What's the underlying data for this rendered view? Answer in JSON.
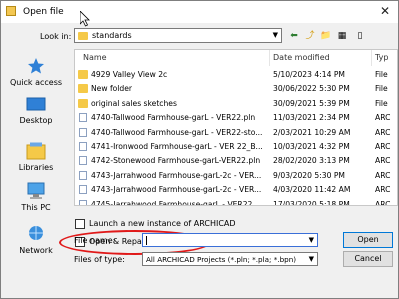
{
  "window": {
    "title": "Open file",
    "close_glyph": "✕"
  },
  "look_in": {
    "label": "Look in:",
    "value": "standards"
  },
  "toolbar": {
    "back": "⬅",
    "up": "⤴",
    "new_folder": "📁",
    "view": "▦",
    "preview": "▯"
  },
  "places": [
    {
      "label": "Quick access",
      "icon": "star-icon"
    },
    {
      "label": "Desktop",
      "icon": "desktop-icon"
    },
    {
      "label": "Libraries",
      "icon": "library-icon"
    },
    {
      "label": "This PC",
      "icon": "computer-icon"
    },
    {
      "label": "Network",
      "icon": "network-icon"
    }
  ],
  "columns": {
    "name": "Name",
    "date": "Date modified",
    "type": "Typ"
  },
  "files": [
    {
      "name": "4929 Valley View 2c",
      "date": "5/10/2023 4:14 PM",
      "type": "File",
      "kind": "folder"
    },
    {
      "name": "New folder",
      "date": "30/06/2022 5:30 PM",
      "type": "File",
      "kind": "folder"
    },
    {
      "name": "original sales sketches",
      "date": "30/09/2021 5:39 PM",
      "type": "File",
      "kind": "folder"
    },
    {
      "name": "4740-Tallwood Farmhouse-garL - VER22.pln",
      "date": "11/03/2021 2:34 PM",
      "type": "ARC",
      "kind": "file"
    },
    {
      "name": "4740-Tallwood Farmhouse-garL - VER22-sto...",
      "date": "2/03/2021 10:29 AM",
      "type": "ARC",
      "kind": "file"
    },
    {
      "name": "4741-Ironwood Farmhouse-garL - VER 22_B...",
      "date": "10/03/2021 4:32 PM",
      "type": "ARC",
      "kind": "file"
    },
    {
      "name": "4742-Stonewood Farmhouse-garL-VER22.pln",
      "date": "28/02/2020 3:13 PM",
      "type": "ARC",
      "kind": "file"
    },
    {
      "name": "4743-Jarrahwood Farmhouse-garL-2c - VER...",
      "date": "9/03/2020 5:30 PM",
      "type": "ARC",
      "kind": "file"
    },
    {
      "name": "4743-Jarrahwood Farmhouse-garL-2c - VER...",
      "date": "4/03/2020 11:42 AM",
      "type": "ARC",
      "kind": "file"
    },
    {
      "name": "4745-Jarrahwood Farmhouse-garL - VER22...",
      "date": "17/03/2020 5:18 PM",
      "type": "ARC",
      "kind": "file"
    }
  ],
  "options": {
    "launch_new_instance": {
      "label": "Launch a new instance of ARCHICAD",
      "checked": false
    },
    "open_repair": {
      "label": "Open & Repair selected file",
      "checked": false
    }
  },
  "file_name": {
    "label": "File name:",
    "value": ""
  },
  "file_type": {
    "label": "Files of type:",
    "value": "All ARCHICAD Projects (*.pln; *.pla; *.bpn)"
  },
  "buttons": {
    "open": "Open",
    "cancel": "Cancel"
  },
  "colors": {
    "highlight_oval": "#e01919",
    "accent": "#0078d7"
  }
}
